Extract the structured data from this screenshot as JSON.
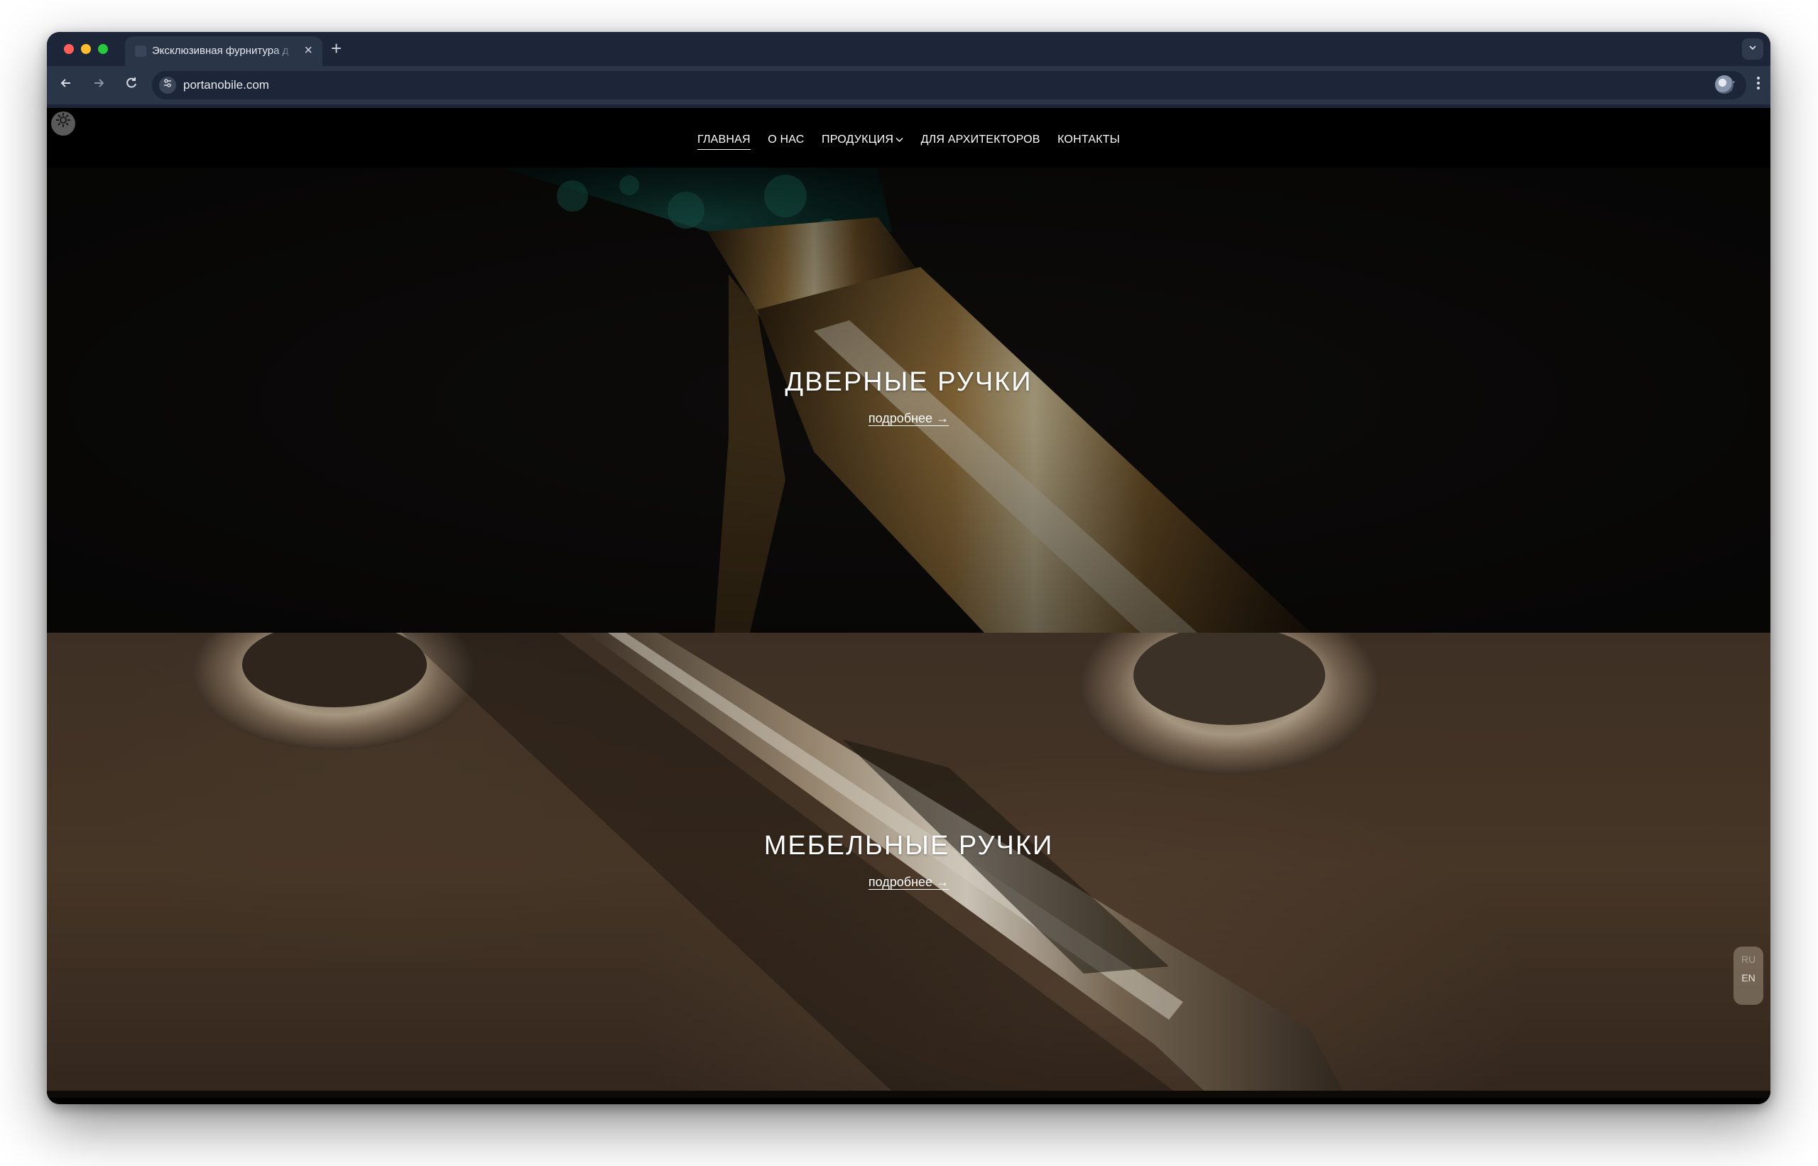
{
  "browser": {
    "tab_title": "Эксклюзивная фурнитура д",
    "tab_close": "×",
    "new_tab": "+",
    "url": "portanobile.com"
  },
  "site": {
    "nav": [
      "ГЛАВНАЯ",
      "О НАС",
      "ПРОДУКЦИЯ",
      "ДЛЯ АРХИТЕКТОРОВ",
      "КОНТАКТЫ"
    ],
    "active_nav": "ГЛАВНАЯ"
  },
  "sections": [
    {
      "title": "ДВЕРНЫЕ РУЧКИ",
      "link": "подробнее →"
    },
    {
      "title": "МЕБЕЛЬНЫЕ РУЧКИ",
      "link": "подробнее →"
    }
  ],
  "lang": {
    "options": [
      "RU",
      "EN"
    ],
    "selected": "EN"
  },
  "icons": {
    "back": "arrow-left-icon",
    "forward": "arrow-right-icon",
    "reload": "reload-icon",
    "site_info": "tune-icon",
    "bookmark": "star-icon",
    "menu": "kebab-icon",
    "settings": "gear-icon"
  },
  "colors": {
    "browser_chrome": "#2a3548",
    "tab_strip": "#1c2638",
    "header_bg": "#000000",
    "section1_bg": "#141210",
    "section2_bg": "#4d3a2c"
  }
}
